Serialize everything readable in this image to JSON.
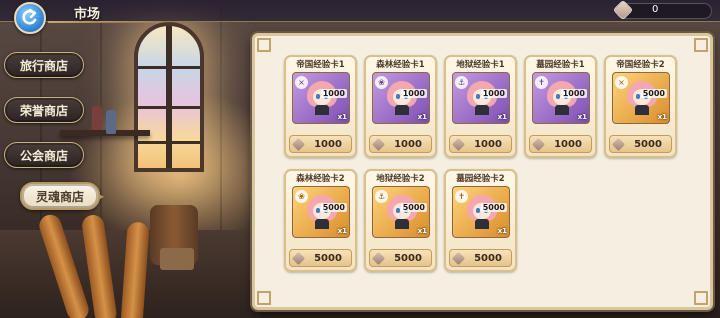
{
  "header": {
    "title": "市场",
    "currency": {
      "icon": "soul-stone-icon",
      "value": "0"
    }
  },
  "sidebar": {
    "items": [
      {
        "label": "旅行商店",
        "active": false
      },
      {
        "label": "荣誉商店",
        "active": false
      },
      {
        "label": "公会商店",
        "active": false
      },
      {
        "label": "灵魂商店",
        "active": true
      }
    ]
  },
  "shop": {
    "currency_icon": "soul-stone-icon",
    "items": [
      {
        "name": "帝国经验卡1",
        "exp": "1000",
        "quantity": "x1",
        "price": "1000",
        "tier": "purple",
        "type_icon": "empire-icon"
      },
      {
        "name": "森林经验卡1",
        "exp": "1000",
        "quantity": "x1",
        "price": "1000",
        "tier": "purple",
        "type_icon": "forest-icon"
      },
      {
        "name": "地狱经验卡1",
        "exp": "1000",
        "quantity": "x1",
        "price": "1000",
        "tier": "purple",
        "type_icon": "hell-icon"
      },
      {
        "name": "墓园经验卡1",
        "exp": "1000",
        "quantity": "x1",
        "price": "1000",
        "tier": "purple",
        "type_icon": "graveyard-icon"
      },
      {
        "name": "帝国经验卡2",
        "exp": "5000",
        "quantity": "x1",
        "price": "5000",
        "tier": "gold",
        "type_icon": "empire-icon"
      },
      {
        "name": "森林经验卡2",
        "exp": "5000",
        "quantity": "x1",
        "price": "5000",
        "tier": "gold",
        "type_icon": "forest-icon"
      },
      {
        "name": "地狱经验卡2",
        "exp": "5000",
        "quantity": "x1",
        "price": "5000",
        "tier": "gold",
        "type_icon": "hell-icon"
      },
      {
        "name": "墓园经验卡2",
        "exp": "5000",
        "quantity": "x1",
        "price": "5000",
        "tier": "gold",
        "type_icon": "graveyard-icon"
      }
    ]
  },
  "colors": {
    "purple_tier": "#7c4fb0",
    "gold_tier": "#d98d2b",
    "panel_bg": "#f5efe1",
    "accent_gold": "#c9b07c"
  }
}
